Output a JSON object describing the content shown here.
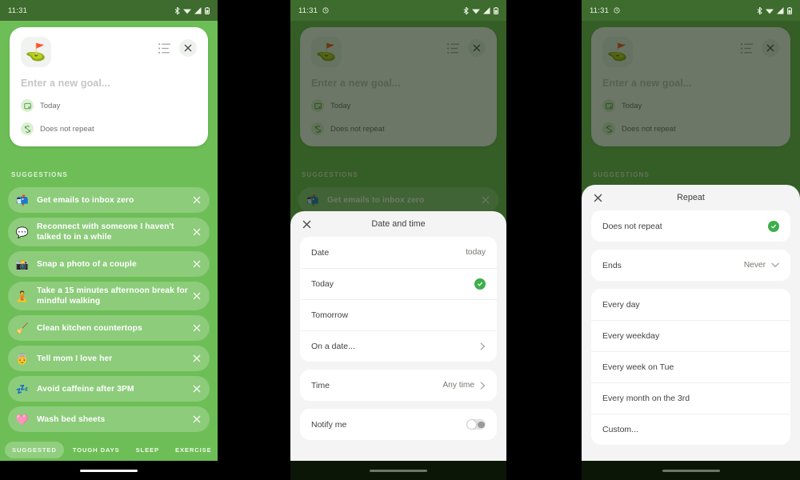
{
  "status_bar": {
    "time": "11:31",
    "icons_left": [
      "alarm-icon"
    ],
    "icons_right": [
      "bluetooth-icon",
      "wifi-icon",
      "signal-icon",
      "battery-icon"
    ]
  },
  "colors": {
    "brand_green": "#6DBE56",
    "status_green": "#3E6B2E",
    "accent_check": "#3DAE4A",
    "sheet_bg": "#F4F4F4",
    "card_white": "#FFFFFF"
  },
  "composer": {
    "goal_emoji": "⛳",
    "placeholder": "Enter a new goal...",
    "list_icon": "list-icon",
    "close_icon": "close-icon",
    "date_chip": {
      "icon": "calendar-icon",
      "label": "Today"
    },
    "repeat_chip": {
      "icon": "repeat-icon",
      "label": "Does not repeat"
    }
  },
  "suggestions": {
    "header": "SUGGESTIONS",
    "items": [
      {
        "emoji": "📬",
        "text": "Get emails to inbox zero"
      },
      {
        "emoji": "💬",
        "text": "Reconnect with someone I haven't talked to in a while"
      },
      {
        "emoji": "📸",
        "text": "Snap a photo of a couple"
      },
      {
        "emoji": "🧘",
        "text": "Take a 15 minutes afternoon break for mindful walking"
      },
      {
        "emoji": "🧹",
        "text": "Clean kitchen countertops"
      },
      {
        "emoji": "👵",
        "text": "Tell mom I love her"
      },
      {
        "emoji": "💤",
        "text": "Avoid caffeine after 3PM"
      },
      {
        "emoji": "🩷",
        "text": "Wash bed sheets"
      }
    ]
  },
  "tabs": [
    {
      "label": "SUGGESTED",
      "active": true
    },
    {
      "label": "TOUGH DAYS",
      "active": false
    },
    {
      "label": "SLEEP",
      "active": false
    },
    {
      "label": "EXERCISE",
      "active": false
    }
  ],
  "date_sheet": {
    "title": "Date and time",
    "close_icon": "close-icon",
    "group1": [
      {
        "label": "Date",
        "value": "today",
        "kind": "value"
      },
      {
        "label": "Today",
        "value": "",
        "kind": "checked"
      },
      {
        "label": "Tomorrow",
        "value": "",
        "kind": "plain"
      },
      {
        "label": "On a date...",
        "value": "",
        "kind": "chevron"
      }
    ],
    "group2": [
      {
        "label": "Time",
        "value": "Any time",
        "kind": "value-chevron"
      }
    ],
    "group3": [
      {
        "label": "Notify me",
        "value": "",
        "kind": "toggle-off"
      }
    ]
  },
  "repeat_sheet": {
    "title": "Repeat",
    "close_icon": "close-icon",
    "group1": [
      {
        "label": "Does not repeat",
        "value": "",
        "kind": "checked"
      }
    ],
    "group2": [
      {
        "label": "Ends",
        "value": "Never",
        "kind": "value-caret"
      }
    ],
    "group3": [
      {
        "label": "Every day",
        "value": "",
        "kind": "plain"
      },
      {
        "label": "Every weekday",
        "value": "",
        "kind": "plain"
      },
      {
        "label": "Every week on Tue",
        "value": "",
        "kind": "plain"
      },
      {
        "label": "Every month on the 3rd",
        "value": "",
        "kind": "plain"
      },
      {
        "label": "Custom...",
        "value": "",
        "kind": "plain"
      }
    ]
  }
}
